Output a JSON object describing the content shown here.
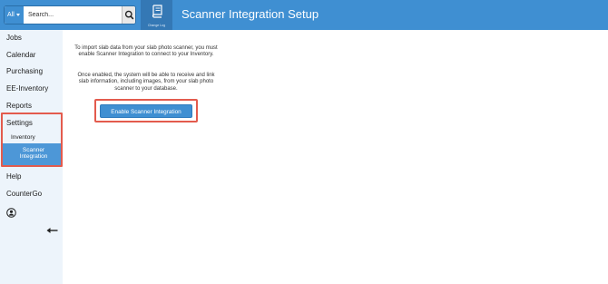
{
  "header": {
    "title": "Scanner Integration Setup",
    "search": {
      "scope": "All",
      "placeholder": "Search..."
    },
    "changelog_label": "Change Log"
  },
  "sidebar": {
    "items": [
      {
        "label": "Jobs"
      },
      {
        "label": "Calendar"
      },
      {
        "label": "Purchasing"
      },
      {
        "label": "EE-Inventory"
      },
      {
        "label": "Reports"
      },
      {
        "label": "Settings"
      },
      {
        "label": "Help"
      },
      {
        "label": "CounterGo"
      }
    ],
    "settings_sub": {
      "inventory": "Inventory",
      "scanner": "Scanner Integration"
    }
  },
  "main": {
    "paragraph1": "To import slab data from your slab photo scanner, you must enable Scanner Integration to connect to your Inventory.",
    "paragraph2": "Once enabled, the system will be able to receive and link slab information, including images, from your slab photo scanner to your database.",
    "enable_button": "Enable Scanner Integration"
  },
  "colors": {
    "accent": "#3f8fd2",
    "highlight": "#e35b4d",
    "sidebar_bg": "#edf4fb"
  }
}
